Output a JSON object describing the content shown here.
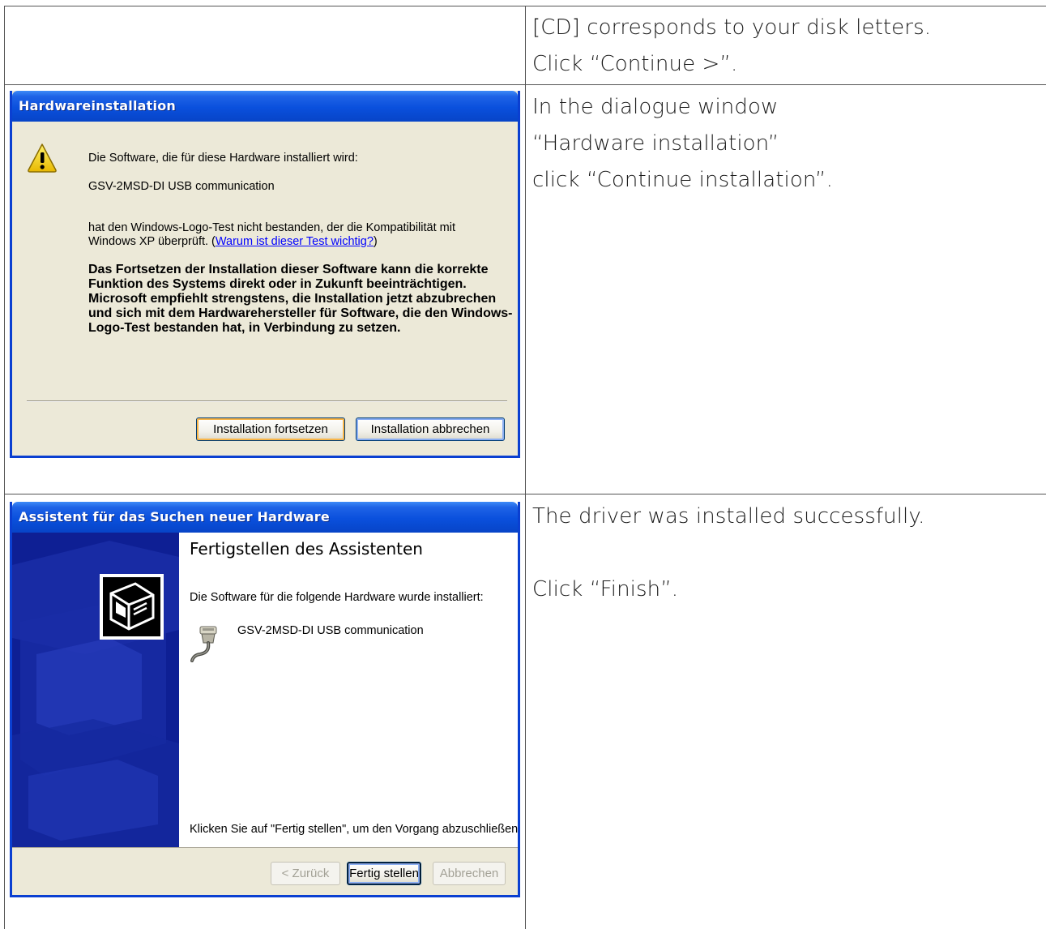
{
  "rows": [
    {
      "description": [
        "[CD] corresponds to your disk letters.",
        "Click “Continue >”."
      ]
    },
    {
      "description": [
        "In the dialogue window",
        "“Hardware installation”",
        "click “Continue installation”."
      ]
    },
    {
      "description": [
        "The driver was installed successfully.",
        "",
        "Click “Finish”."
      ]
    }
  ],
  "hardware_dialog": {
    "title": "Hardwareinstallation",
    "icon": "warning-icon",
    "line1": "Die Software, die für diese Hardware installiert wird:",
    "device": "GSV-2MSD-DI USB communication",
    "logo_test_line1": "hat den Windows-Logo-Test nicht bestanden, der die Kompatibilität mit",
    "logo_test_line2_prefix": "Windows XP überprüft. (",
    "logo_test_link": "Warum ist dieser Test wichtig?",
    "logo_test_line2_suffix": ")",
    "warning_bold": "Das Fortsetzen der Installation dieser Software kann die korrekte Funktion des Systems direkt oder in Zukunft beeinträchtigen. Microsoft empfiehlt strengstens, die Installation jetzt abzubrechen und sich mit dem Hardwarehersteller für Software, die den Windows-Logo-Test bestanden hat, in Verbindung zu setzen.",
    "continue_button": "Installation fortsetzen",
    "cancel_button": "Installation abbrechen"
  },
  "wizard_dialog": {
    "title": "Assistent für das Suchen neuer Hardware",
    "heading": "Fertigstellen des Assistenten",
    "installed_text": "Die Software für die folgende Hardware wurde installiert:",
    "device": "GSV-2MSD-DI USB communication",
    "device_icon": "usb-device-icon",
    "finish_hint": "Klicken Sie auf \"Fertig stellen\", um den Vorgang abzuschließen.",
    "back_button": "< Zurück",
    "finish_button": "Fertig stellen",
    "cancel_button": "Abbrechen"
  }
}
